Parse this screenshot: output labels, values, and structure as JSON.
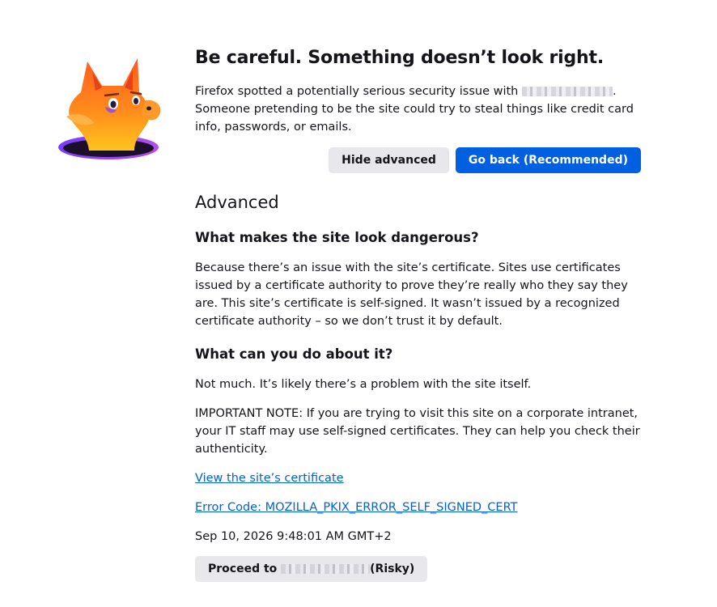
{
  "page": {
    "heading": "Be careful. Something doesn’t look right.",
    "intro_prefix": "Firefox spotted a potentially serious security issue with",
    "intro_suffix": ". Someone pretending to be the site could try to steal things like credit card info, passwords, or emails.",
    "hide_advanced_label": "Hide advanced",
    "go_back_label": "Go back (Recommended)"
  },
  "advanced": {
    "heading": "Advanced",
    "q1": "What makes the site look dangerous?",
    "a1": "Because there’s an issue with the site’s certificate. Sites use certificates issued by a certificate authority to prove they’re really who they say they are. This site’s certificate is self-signed. It wasn’t issued by a recognized certificate authority – so we don’t trust it by default.",
    "q2": "What can you do about it?",
    "a2": "Not much. It’s likely there’s a problem with the site itself.",
    "note": "IMPORTANT NOTE: If you are trying to visit this site on a corporate intranet, your IT staff may use self-signed certificates. They can help you check their authenticity.",
    "view_cert_link": "View the site’s certificate",
    "error_code_link": "Error Code: MOZILLA_PKIX_ERROR_SELF_SIGNED_CERT",
    "timestamp": "Sep 10, 2026 9:48:01 AM GMT+2",
    "proceed_prefix": "Proceed to ",
    "proceed_suffix": "(Risky)"
  },
  "colors": {
    "primary": "#0060df",
    "secondary_bg": "#e8e8ec",
    "text": "#15141a"
  },
  "icons": {
    "illustration": "fox-peeking-from-hole-illustration"
  }
}
